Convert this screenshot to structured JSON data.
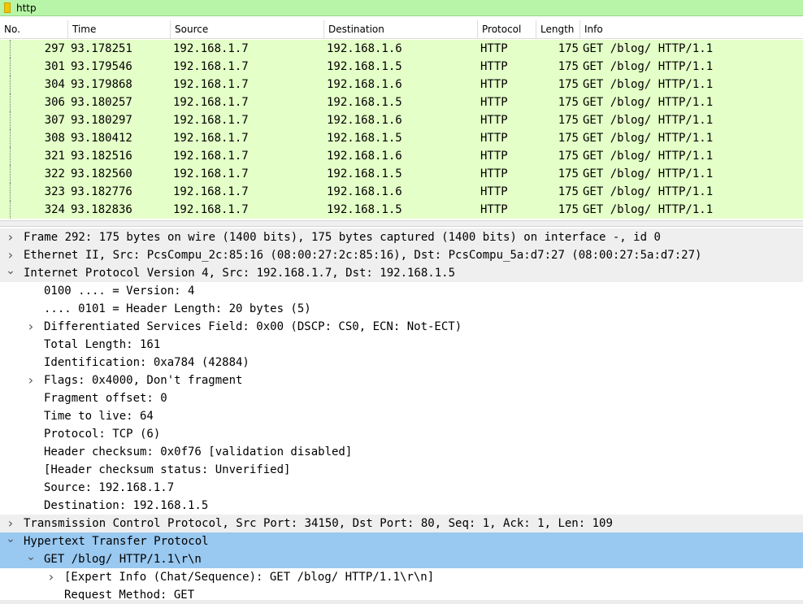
{
  "filter": {
    "value": "http"
  },
  "columns": {
    "no": "No.",
    "time": "Time",
    "source": "Source",
    "destination": "Destination",
    "protocol": "Protocol",
    "length": "Length",
    "info": "Info"
  },
  "colors": {
    "http_row": "#e4ffc7",
    "filter_ok": "#b8f5a8",
    "selection": "#99c8f0"
  },
  "packets": [
    {
      "no": "297",
      "time": "93.178251",
      "source": "192.168.1.7",
      "destination": "192.168.1.6",
      "protocol": "HTTP",
      "length": "175",
      "info": "GET /blog/ HTTP/1.1"
    },
    {
      "no": "301",
      "time": "93.179546",
      "source": "192.168.1.7",
      "destination": "192.168.1.5",
      "protocol": "HTTP",
      "length": "175",
      "info": "GET /blog/ HTTP/1.1"
    },
    {
      "no": "304",
      "time": "93.179868",
      "source": "192.168.1.7",
      "destination": "192.168.1.6",
      "protocol": "HTTP",
      "length": "175",
      "info": "GET /blog/ HTTP/1.1"
    },
    {
      "no": "306",
      "time": "93.180257",
      "source": "192.168.1.7",
      "destination": "192.168.1.5",
      "protocol": "HTTP",
      "length": "175",
      "info": "GET /blog/ HTTP/1.1"
    },
    {
      "no": "307",
      "time": "93.180297",
      "source": "192.168.1.7",
      "destination": "192.168.1.6",
      "protocol": "HTTP",
      "length": "175",
      "info": "GET /blog/ HTTP/1.1"
    },
    {
      "no": "308",
      "time": "93.180412",
      "source": "192.168.1.7",
      "destination": "192.168.1.5",
      "protocol": "HTTP",
      "length": "175",
      "info": "GET /blog/ HTTP/1.1"
    },
    {
      "no": "321",
      "time": "93.182516",
      "source": "192.168.1.7",
      "destination": "192.168.1.6",
      "protocol": "HTTP",
      "length": "175",
      "info": "GET /blog/ HTTP/1.1"
    },
    {
      "no": "322",
      "time": "93.182560",
      "source": "192.168.1.7",
      "destination": "192.168.1.5",
      "protocol": "HTTP",
      "length": "175",
      "info": "GET /blog/ HTTP/1.1"
    },
    {
      "no": "323",
      "time": "93.182776",
      "source": "192.168.1.7",
      "destination": "192.168.1.6",
      "protocol": "HTTP",
      "length": "175",
      "info": "GET /blog/ HTTP/1.1"
    },
    {
      "no": "324",
      "time": "93.182836",
      "source": "192.168.1.7",
      "destination": "192.168.1.5",
      "protocol": "HTTP",
      "length": "175",
      "info": "GET /blog/ HTTP/1.1"
    }
  ],
  "details": [
    {
      "text": "Frame 292: 175 bytes on wire (1400 bits), 175 bytes captured (1400 bits) on interface -, id 0",
      "depth": 0,
      "arrow": "collapsed",
      "style": "top"
    },
    {
      "text": "Ethernet II, Src: PcsCompu_2c:85:16 (08:00:27:2c:85:16), Dst: PcsCompu_5a:d7:27 (08:00:27:5a:d7:27)",
      "depth": 0,
      "arrow": "collapsed",
      "style": "top"
    },
    {
      "text": "Internet Protocol Version 4, Src: 192.168.1.7, Dst: 192.168.1.5",
      "depth": 0,
      "arrow": "expanded",
      "style": "top"
    },
    {
      "text": "0100 .... = Version: 4",
      "depth": 1,
      "arrow": "none",
      "style": ""
    },
    {
      "text": ".... 0101 = Header Length: 20 bytes (5)",
      "depth": 1,
      "arrow": "none",
      "style": ""
    },
    {
      "text": "Differentiated Services Field: 0x00 (DSCP: CS0, ECN: Not-ECT)",
      "depth": 1,
      "arrow": "collapsed",
      "style": ""
    },
    {
      "text": "Total Length: 161",
      "depth": 1,
      "arrow": "none",
      "style": ""
    },
    {
      "text": "Identification: 0xa784 (42884)",
      "depth": 1,
      "arrow": "none",
      "style": ""
    },
    {
      "text": "Flags: 0x4000, Don't fragment",
      "depth": 1,
      "arrow": "collapsed",
      "style": ""
    },
    {
      "text": "Fragment offset: 0",
      "depth": 1,
      "arrow": "none",
      "style": ""
    },
    {
      "text": "Time to live: 64",
      "depth": 1,
      "arrow": "none",
      "style": ""
    },
    {
      "text": "Protocol: TCP (6)",
      "depth": 1,
      "arrow": "none",
      "style": ""
    },
    {
      "text": "Header checksum: 0x0f76 [validation disabled]",
      "depth": 1,
      "arrow": "none",
      "style": ""
    },
    {
      "text": "[Header checksum status: Unverified]",
      "depth": 1,
      "arrow": "none",
      "style": ""
    },
    {
      "text": "Source: 192.168.1.7",
      "depth": 1,
      "arrow": "none",
      "style": ""
    },
    {
      "text": "Destination: 192.168.1.5",
      "depth": 1,
      "arrow": "none",
      "style": ""
    },
    {
      "text": "Transmission Control Protocol, Src Port: 34150, Dst Port: 80, Seq: 1, Ack: 1, Len: 109",
      "depth": 0,
      "arrow": "collapsed",
      "style": "top"
    },
    {
      "text": "Hypertext Transfer Protocol",
      "depth": 0,
      "arrow": "expanded",
      "style": "sel"
    },
    {
      "text": "GET /blog/ HTTP/1.1\\r\\n",
      "depth": 1,
      "arrow": "expanded",
      "style": "sel"
    },
    {
      "text": "[Expert Info (Chat/Sequence): GET /blog/ HTTP/1.1\\r\\n]",
      "depth": 2,
      "arrow": "collapsed",
      "style": ""
    },
    {
      "text": "Request Method: GET",
      "depth": 2,
      "arrow": "none",
      "style": ""
    }
  ]
}
